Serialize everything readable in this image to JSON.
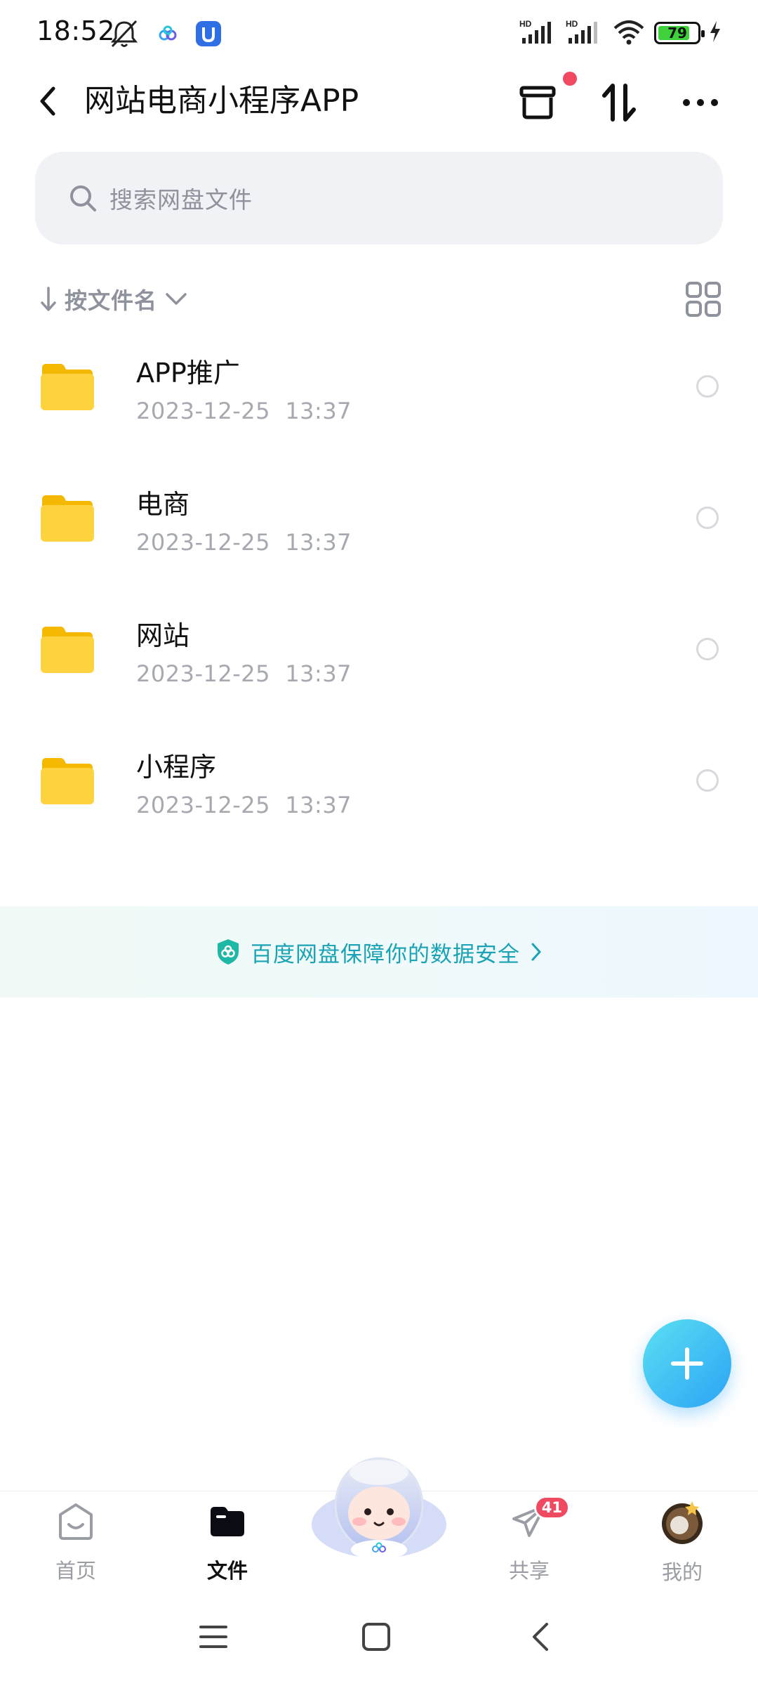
{
  "status_bar": {
    "time": "18:52",
    "battery_level": "79",
    "icons": [
      "mute-bell-icon",
      "baidu-netdisk-icon",
      "app-notification-icon",
      "hd-signal-icon",
      "hd-signal-icon",
      "wifi-icon",
      "battery-icon",
      "charging-icon"
    ]
  },
  "header": {
    "title": "网站电商小程序APP",
    "actions": [
      "transfer-box-icon",
      "sort-transfer-icon",
      "more-icon"
    ]
  },
  "search": {
    "placeholder": "搜索网盘文件"
  },
  "sort": {
    "label": "按文件名"
  },
  "files": [
    {
      "name": "APP推广",
      "date": "2023-12-25  13:37"
    },
    {
      "name": "电商",
      "date": "2023-12-25  13:37"
    },
    {
      "name": "网站",
      "date": "2023-12-25  13:37"
    },
    {
      "name": "小程序",
      "date": "2023-12-25  13:37"
    }
  ],
  "security_banner": {
    "text": "百度网盘保障你的数据安全"
  },
  "bottom_nav": {
    "items": [
      {
        "label": "首页",
        "icon": "home-icon",
        "active": false
      },
      {
        "label": "文件",
        "icon": "folder-icon",
        "active": true
      },
      {
        "label": "",
        "icon": "mascot-icon",
        "active": false
      },
      {
        "label": "共享",
        "icon": "share-icon",
        "active": false,
        "badge": "41"
      },
      {
        "label": "我的",
        "icon": "avatar",
        "active": false
      }
    ]
  },
  "colors": {
    "accent": "#2ba3f5",
    "folder": "#ffd23f",
    "badge": "#f04a62",
    "security_text": "#1aa3b5"
  }
}
